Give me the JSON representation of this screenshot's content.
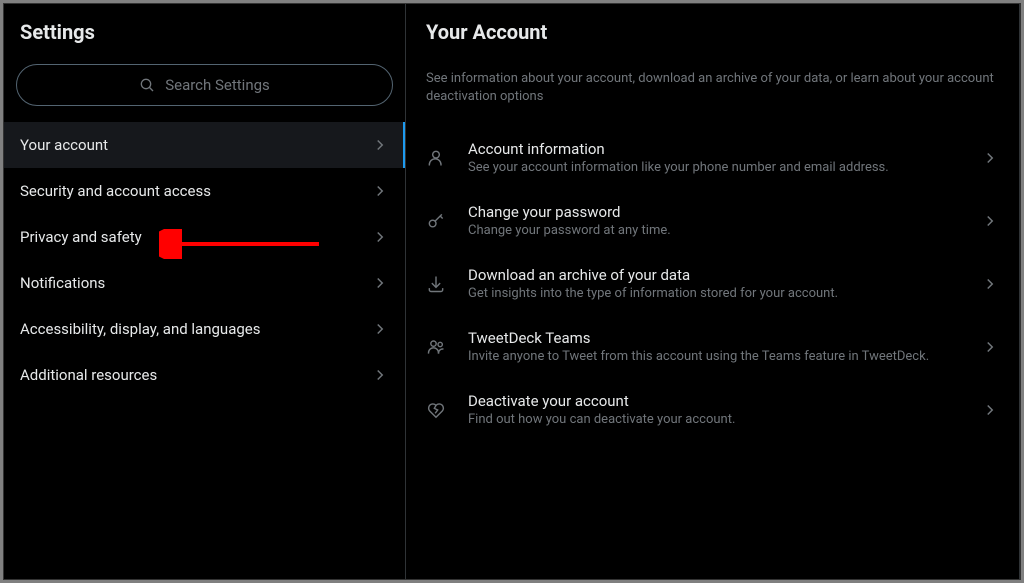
{
  "sidebar": {
    "title": "Settings",
    "search_placeholder": "Search Settings",
    "items": [
      {
        "label": "Your account",
        "active": true
      },
      {
        "label": "Security and account access",
        "active": false
      },
      {
        "label": "Privacy and safety",
        "active": false
      },
      {
        "label": "Notifications",
        "active": false
      },
      {
        "label": "Accessibility, display, and languages",
        "active": false
      },
      {
        "label": "Additional resources",
        "active": false
      }
    ]
  },
  "main": {
    "title": "Your Account",
    "description": "See information about your account, download an archive of your data, or learn about your account deactivation options",
    "options": [
      {
        "title": "Account information",
        "subtitle": "See your account information like your phone number and email address."
      },
      {
        "title": "Change your password",
        "subtitle": "Change your password at any time."
      },
      {
        "title": "Download an archive of your data",
        "subtitle": "Get insights into the type of information stored for your account."
      },
      {
        "title": "TweetDeck Teams",
        "subtitle": "Invite anyone to Tweet from this account using the Teams feature in TweetDeck."
      },
      {
        "title": "Deactivate your account",
        "subtitle": "Find out how you can deactivate your account."
      }
    ]
  }
}
